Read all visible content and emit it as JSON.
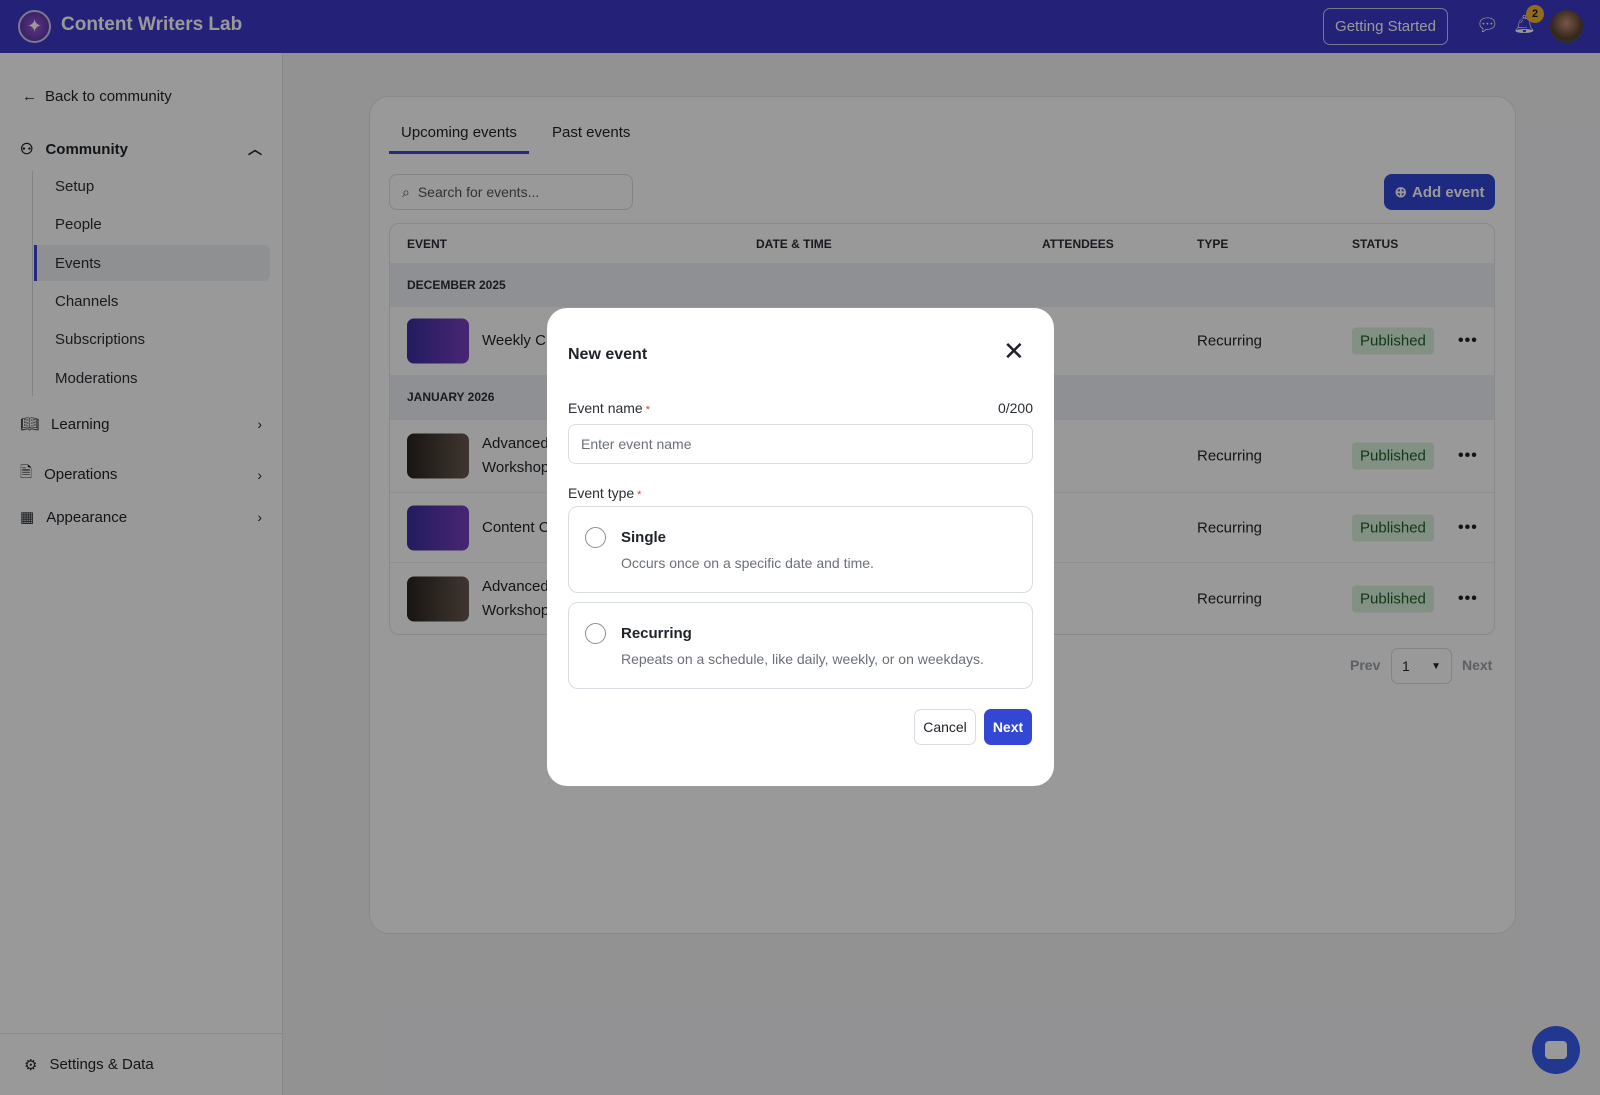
{
  "header": {
    "brand": "Content Writers Lab",
    "getting_started": "Getting Started",
    "notification_count": "2"
  },
  "sidebar": {
    "back": "Back to community",
    "community": "Community",
    "community_items": [
      "Setup",
      "People",
      "Events",
      "Channels",
      "Subscriptions",
      "Moderations"
    ],
    "learning": "Learning",
    "operations": "Operations",
    "appearance": "Appearance",
    "settings": "Settings & Data"
  },
  "main": {
    "tabs": [
      "Upcoming events",
      "Past events"
    ],
    "search_placeholder": "Search for events...",
    "add_event": "Add event",
    "columns": [
      "EVENT",
      "DATE & TIME",
      "ATTENDEES",
      "TYPE",
      "STATUS"
    ],
    "groups": [
      "DECEMBER 2025",
      "JANUARY 2026"
    ],
    "rows": [
      {
        "name": "Weekly C",
        "type": "Recurring",
        "status": "Published"
      },
      {
        "name": "Advanced",
        "name2": "Workshop",
        "type": "Recurring",
        "status": "Published"
      },
      {
        "name": "Content C",
        "type": "Recurring",
        "status": "Published"
      },
      {
        "name": "Advanced",
        "name2": "Workshop",
        "type": "Recurring",
        "status": "Published"
      }
    ],
    "pagination": {
      "prev": "Prev",
      "page": "1",
      "next": "Next"
    }
  },
  "modal": {
    "title": "New event",
    "name_label": "Event name",
    "required": "*",
    "count": "0/200",
    "name_placeholder": "Enter event name",
    "type_label": "Event type",
    "options": [
      {
        "title": "Single",
        "desc": "Occurs once on a specific date and time."
      },
      {
        "title": "Recurring",
        "desc": "Repeats on a schedule, like daily, weekly, or on weekdays."
      }
    ],
    "cancel": "Cancel",
    "next": "Next"
  }
}
